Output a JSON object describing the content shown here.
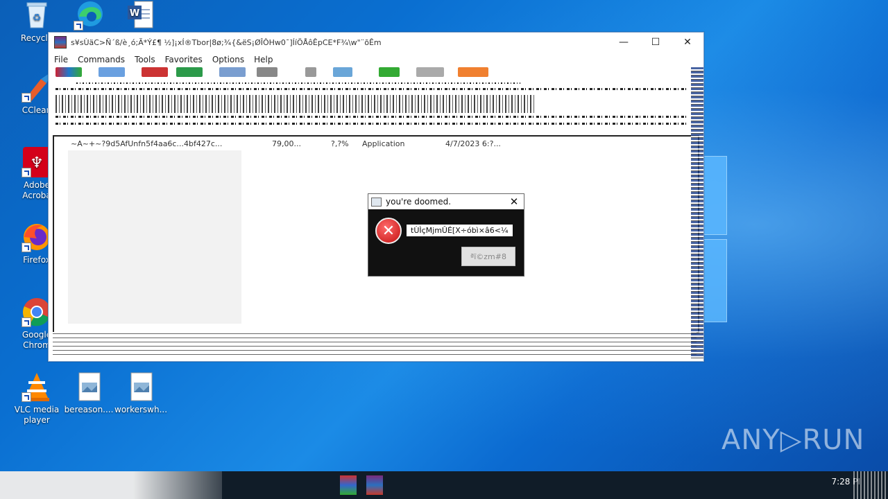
{
  "desktop": {
    "icons": [
      {
        "label": "Recycle",
        "icon": "recycle-bin-icon"
      },
      {
        "label": "",
        "icon": "edge-icon"
      },
      {
        "label": "",
        "icon": "word-doc-icon"
      },
      {
        "label": "CClean",
        "icon": "ccleaner-icon"
      },
      {
        "label": "Adobe\nAcroba",
        "icon": "acrobat-icon"
      },
      {
        "label": "Firefox",
        "icon": "firefox-icon"
      },
      {
        "label": "Google\nChrom",
        "icon": "chrome-icon"
      },
      {
        "label": "VLC media\nplayer",
        "icon": "vlc-icon"
      },
      {
        "label": "bereason....",
        "icon": "image-file-icon"
      },
      {
        "label": "workerswh...",
        "icon": "image-file-icon"
      }
    ]
  },
  "window": {
    "title": "s¥sÙäC>Ñ´ß/è¸ó;Ã*Ý£¶ ½]¡xÍ®Tbor|8ø;¾{&ëS¡ØÎÔHw0¯]ÍíÖÅôÊpCE*F¾\\w\"¨õÊm",
    "menu": [
      "File",
      "Commands",
      "Tools",
      "Favorites",
      "Options",
      "Help"
    ],
    "controls": {
      "minimize": "—",
      "maximize": "☐",
      "close": "✕"
    },
    "file_row": {
      "name": "~A~+~?9d5AfUnfn5f4aa6c...4bf427c...",
      "size": "79,00...",
      "ratio": "?,?%",
      "type": "Application",
      "modified": "4/7/2023 6:?..."
    }
  },
  "dialog": {
    "title": "you're doomed.",
    "close": "✕",
    "message": "tÙÌçMjmÛÉ[X÷óbì×â6<¼",
    "button": "ªï©zm#8"
  },
  "taskbar": {
    "clock": "7:28 PI"
  },
  "watermark": {
    "text": "ANY▷RUN"
  },
  "colors": {
    "desktop_accent": "#0a6fd1",
    "taskbar": "#101c28",
    "error_red": "#c41010"
  }
}
